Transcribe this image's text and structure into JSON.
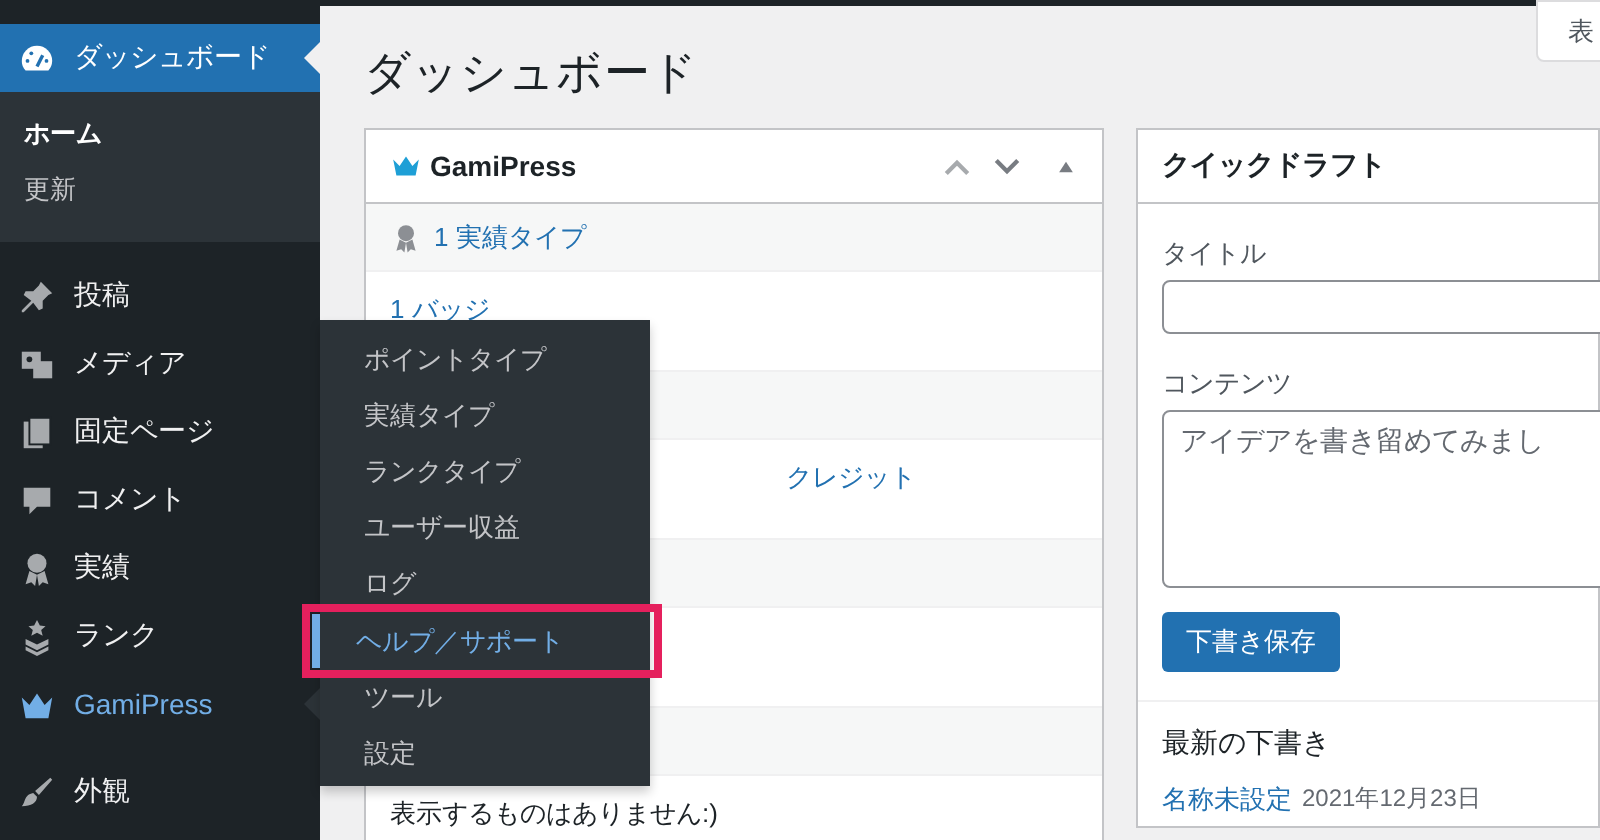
{
  "sidebar": {
    "items": [
      {
        "label": "ダッシュボード",
        "selected": true,
        "children": [
          {
            "label": "ホーム",
            "selected": true
          },
          {
            "label": "更新",
            "selected": false
          }
        ]
      },
      {
        "label": "投稿",
        "selected": false
      },
      {
        "label": "メディア",
        "selected": false
      },
      {
        "label": "固定ページ",
        "selected": false
      },
      {
        "label": "コメント",
        "selected": false
      },
      {
        "label": "実績",
        "selected": false
      },
      {
        "label": "ランク",
        "selected": false
      },
      {
        "label": "GamiPress",
        "selected": false,
        "hovered": true
      },
      {
        "label": "外観",
        "selected": false
      }
    ]
  },
  "flyout": {
    "items": [
      {
        "label": "ポイントタイプ",
        "selected": false,
        "highlighted": false
      },
      {
        "label": "実績タイプ",
        "selected": false,
        "highlighted": false
      },
      {
        "label": "ランクタイプ",
        "selected": false,
        "highlighted": false
      },
      {
        "label": "ユーザー収益",
        "selected": false,
        "highlighted": false
      },
      {
        "label": "ログ",
        "selected": false,
        "highlighted": false
      },
      {
        "label": "ヘルプ／サポート",
        "selected": true,
        "highlighted": true
      },
      {
        "label": "ツール",
        "selected": false,
        "highlighted": false
      },
      {
        "label": "設定",
        "selected": false,
        "highlighted": false
      }
    ]
  },
  "page_title": "ダッシュボード",
  "screen_options_button": "表",
  "gamipress_widget": {
    "title": "GamiPress",
    "rows": [
      {
        "kind": "header",
        "text": "1 実績タイプ"
      },
      {
        "kind": "body",
        "text": "1 バッジ"
      },
      {
        "kind": "header"
      },
      {
        "kind": "body",
        "column_2": "クレジット"
      },
      {
        "kind": "header"
      },
      {
        "kind": "body"
      },
      {
        "kind": "header"
      },
      {
        "kind": "body",
        "text": "表示するものはありません:)"
      }
    ]
  },
  "quick_draft": {
    "title": "クイックドラフト",
    "title_label": "タイトル",
    "content_label": "コンテンツ",
    "content_placeholder": "アイデアを書き留めてみまし",
    "save_button": "下書き保存",
    "recent_heading": "最新の下書き",
    "drafts": [
      {
        "title": "名称未設定",
        "date": "2021年12月23日"
      }
    ]
  }
}
